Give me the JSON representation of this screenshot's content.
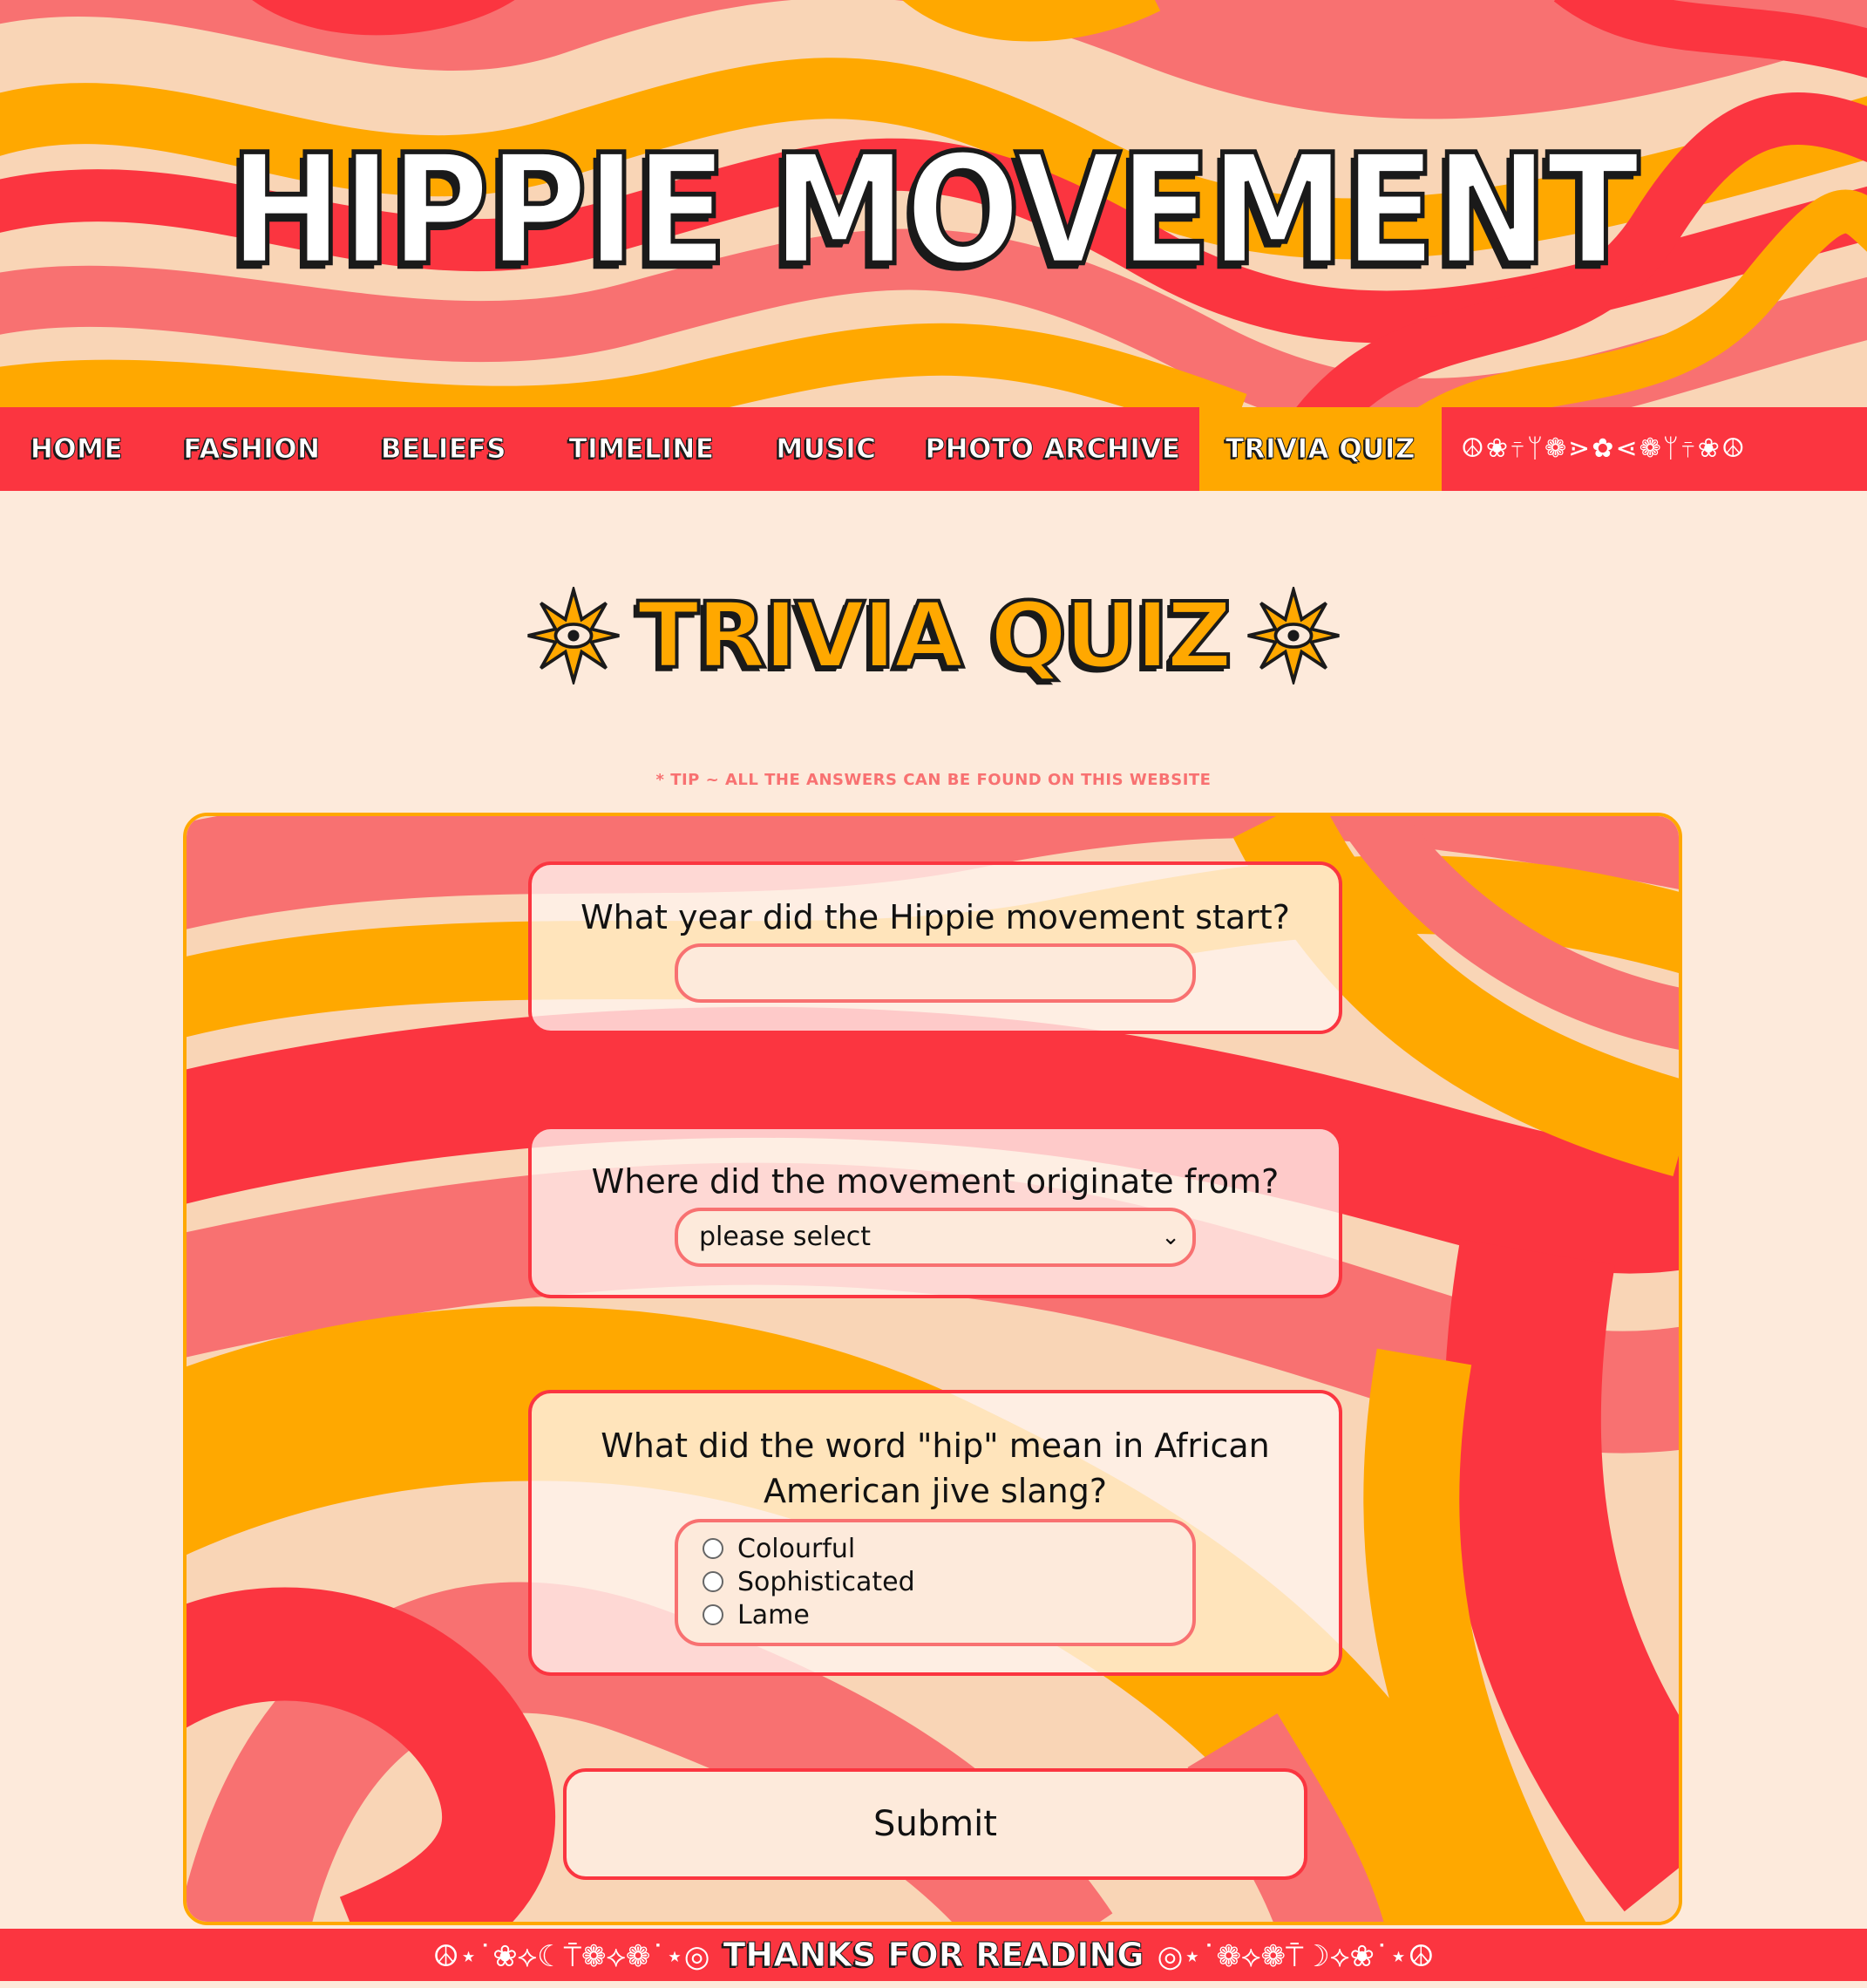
{
  "colors": {
    "red": "#fb3540",
    "orange": "#ffa800",
    "coral": "#f87171",
    "peach": "#f9d5b6",
    "cream": "#fdeadb"
  },
  "header": {
    "title": "HIPPIE MOVEMENT"
  },
  "nav": {
    "items": [
      "HOME",
      "FASHION",
      "BELIEFS",
      "TIMELINE",
      "MUSIC",
      "PHOTO ARCHIVE",
      "TRIVIA QUIZ"
    ],
    "active": "TRIVIA QUIZ",
    "decoration": "☮❀⍑ᛘ❁⋗✿⋖❁ᛘ⍑❀☮"
  },
  "page": {
    "heading": "TRIVIA QUIZ",
    "heading_icon": "sun-eye-icon",
    "tip": "* TIP ~ ALL THE ANSWERS CAN BE FOUND ON THIS WEBSITE"
  },
  "quiz": {
    "questions": [
      {
        "text": "What year did the Hippie movement start?",
        "type": "text",
        "value": ""
      },
      {
        "text": "Where did the movement originate from?",
        "type": "select",
        "selected": "please select"
      },
      {
        "text": "What did the word \"hip\" mean in African American jive slang?",
        "type": "radio",
        "options": [
          "Colourful",
          "Sophisticated",
          "Lame"
        ]
      }
    ],
    "submit_label": "Submit"
  },
  "footer": {
    "deco_left": "☮⋆˙❀⟡☾⍑❁⟡❁˙⋆◎",
    "text": "THANKS FOR READING",
    "deco_right": "◎⋆˙❁⟡❁⍑☽⟡❀˙⋆☮"
  }
}
